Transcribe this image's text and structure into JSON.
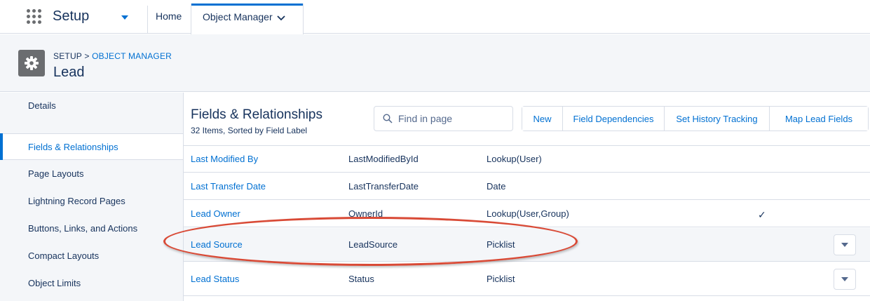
{
  "topnav": {
    "app_name": "Setup",
    "home_label": "Home",
    "active_tab_label": "Object Manager",
    "accent": "#0070d2"
  },
  "header": {
    "breadcrumb_setup": "SETUP",
    "breadcrumb_sep": ">",
    "breadcrumb_link": "OBJECT MANAGER",
    "title": "Lead",
    "icon": "gear-icon"
  },
  "sidebar": {
    "items": [
      {
        "label": "Details",
        "active": false
      },
      {
        "label": "Fields & Relationships",
        "active": true
      },
      {
        "label": "Page Layouts",
        "active": false
      },
      {
        "label": "Lightning Record Pages",
        "active": false
      },
      {
        "label": "Buttons, Links, and Actions",
        "active": false
      },
      {
        "label": "Compact Layouts",
        "active": false
      },
      {
        "label": "Object Limits",
        "active": false
      }
    ]
  },
  "main": {
    "title": "Fields & Relationships",
    "subtitle": "32 Items, Sorted by Field Label",
    "search": {
      "placeholder": "Find in page",
      "value": ""
    },
    "buttons": [
      "New",
      "Field Dependencies",
      "Set History Tracking",
      "Map Lead Fields"
    ]
  },
  "table": {
    "rows": [
      {
        "label": "Last Modified By",
        "api_name": "LastModifiedById",
        "type": "Lookup(User)",
        "indexed": false,
        "menu": false
      },
      {
        "label": "Last Transfer Date",
        "api_name": "LastTransferDate",
        "type": "Date",
        "indexed": false,
        "menu": false
      },
      {
        "label": "Lead Owner",
        "api_name": "OwnerId",
        "type": "Lookup(User,Group)",
        "indexed": true,
        "menu": false
      },
      {
        "label": "Lead Source",
        "api_name": "LeadSource",
        "type": "Picklist",
        "indexed": false,
        "menu": true
      },
      {
        "label": "Lead Status",
        "api_name": "Status",
        "type": "Picklist",
        "indexed": false,
        "menu": true
      }
    ],
    "check_glyph": "✓"
  },
  "annotation": {
    "color": "#d94a36"
  }
}
